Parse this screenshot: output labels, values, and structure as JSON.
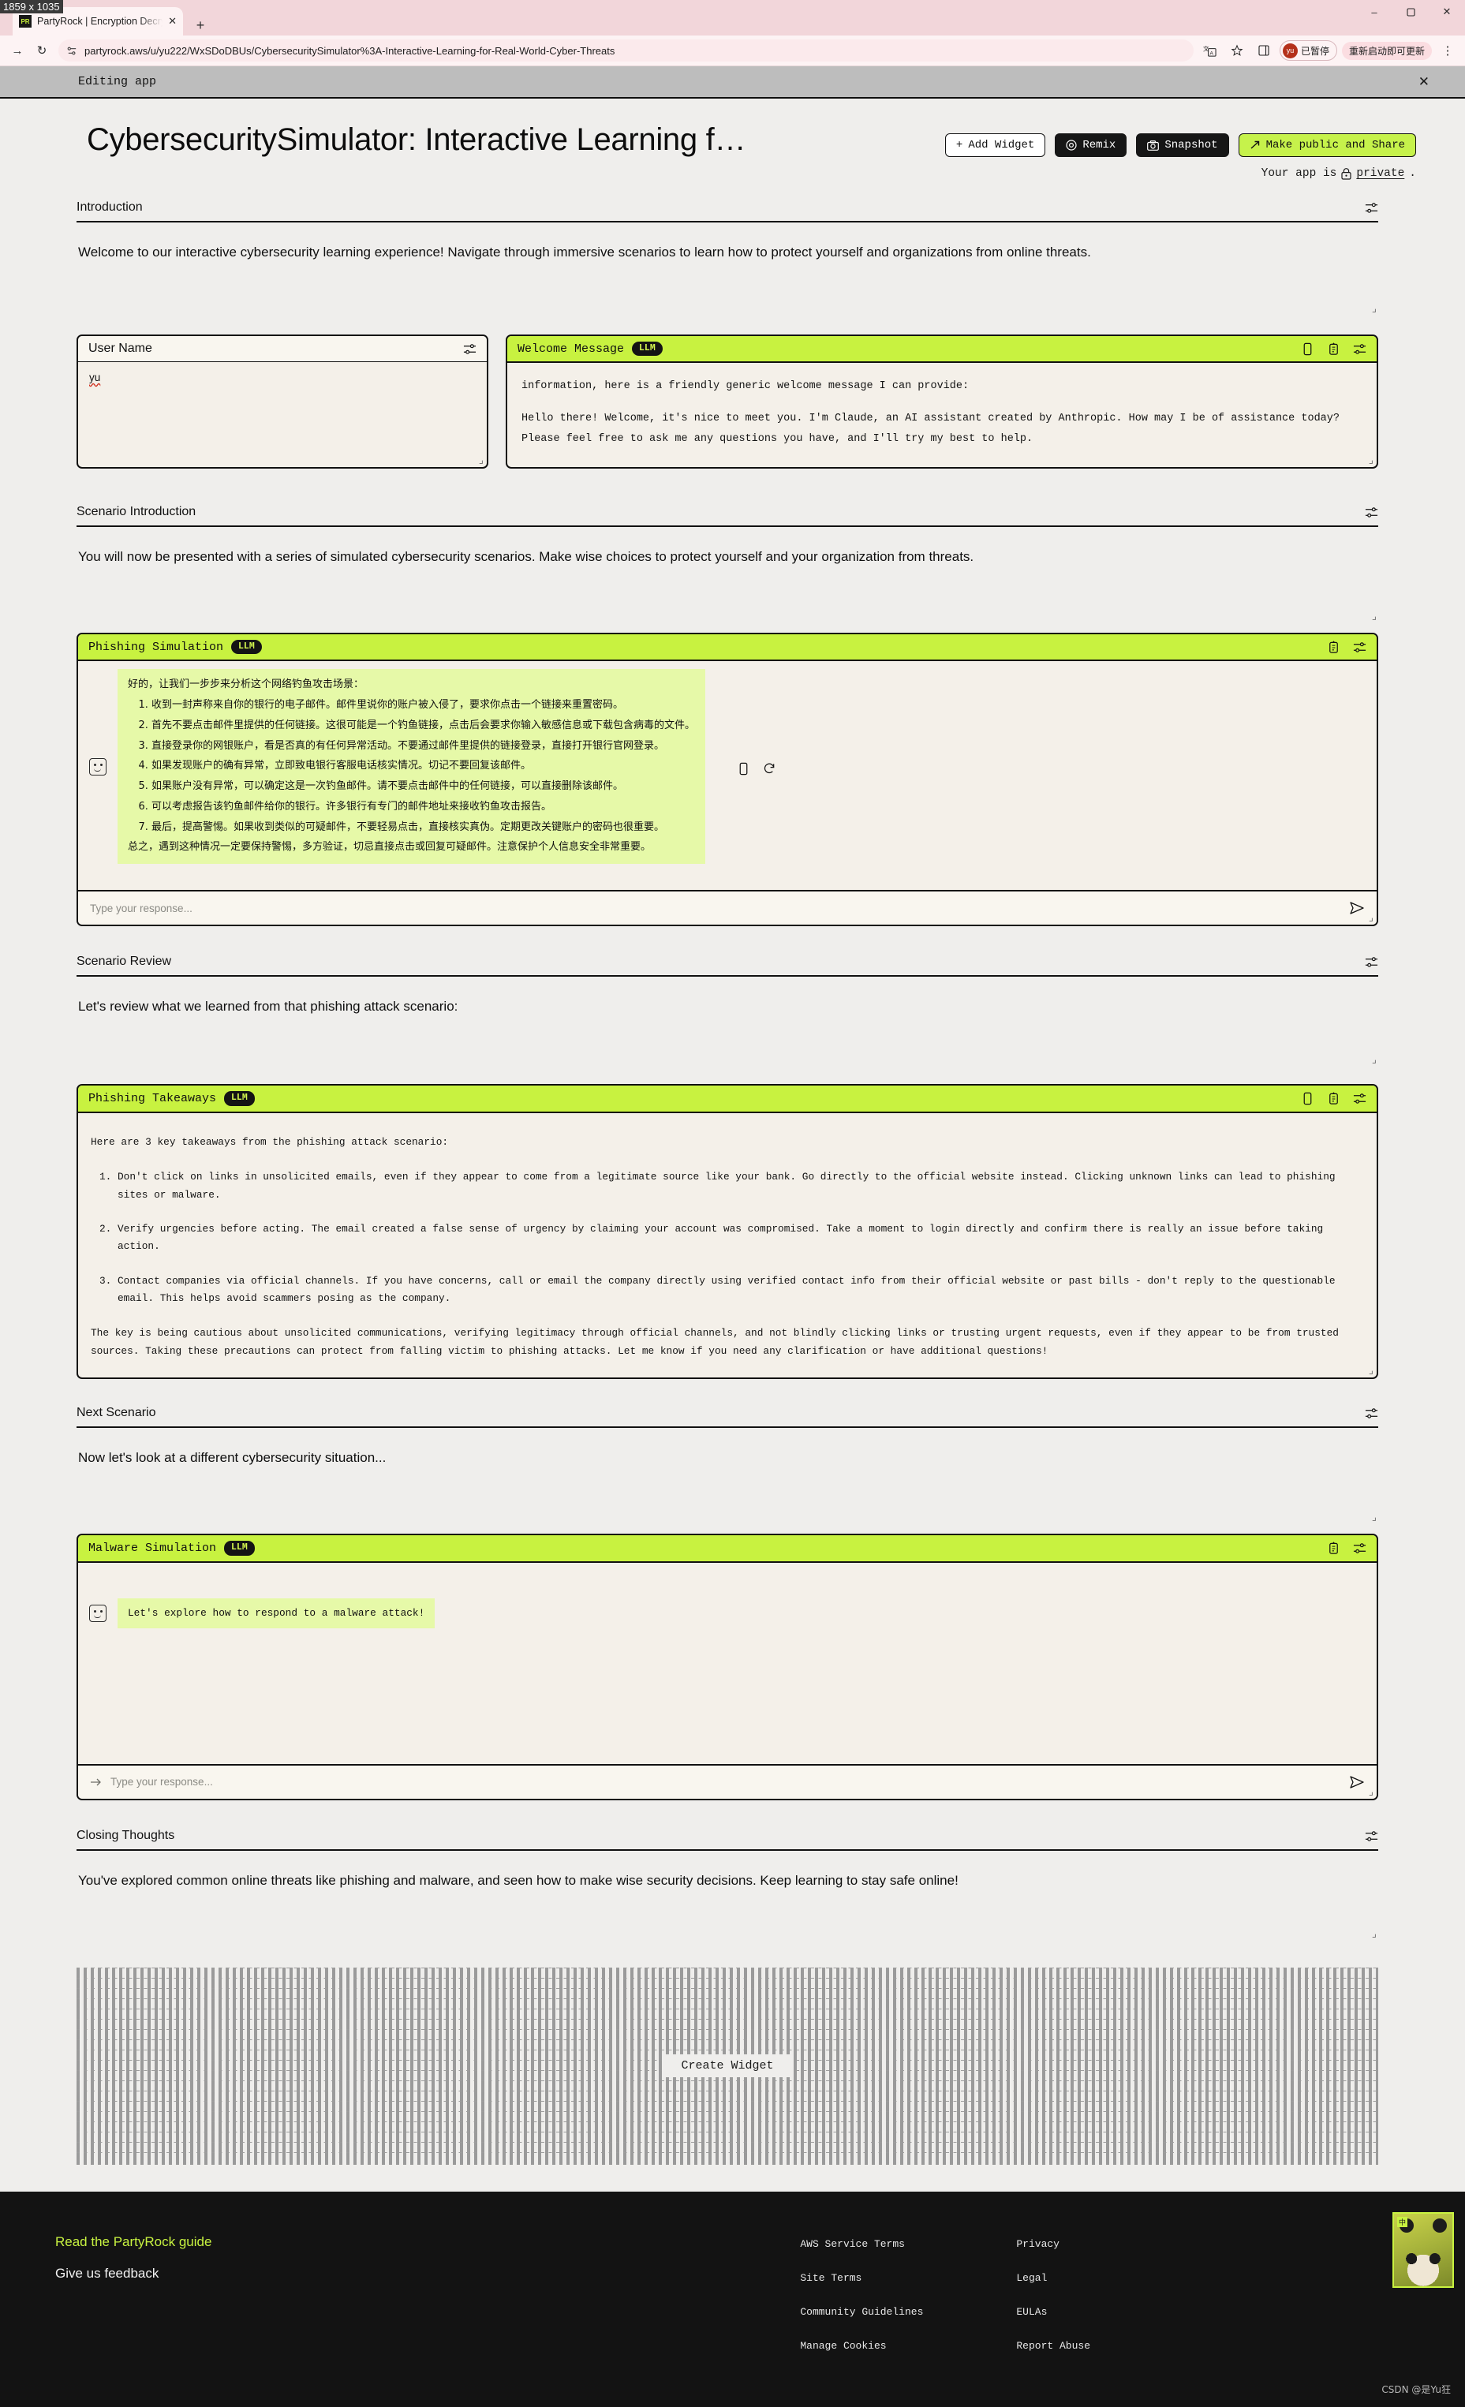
{
  "browser": {
    "size_badge": "1859 x 1035",
    "tab": {
      "favicon_text": "PR",
      "title": "PartyRock | Encryption Decry",
      "close_icon": "close-icon"
    },
    "new_tab_label": "+",
    "window_controls": {
      "minimize": "–",
      "maximize": "❐",
      "close": "✕"
    },
    "nav": {
      "forward": "→",
      "reload": "↻"
    },
    "url": "partyrock.aws/u/yu222/WxSDoDBUs/CybersecuritySimulator%3A-Interactive-Learning-for-Real-World-Cyber-Threats",
    "profile": {
      "avatar_initials": "yu",
      "status_text": "已暂停"
    },
    "update_pill": "重新启动即可更新"
  },
  "editing_bar": {
    "label": "Editing app",
    "close_icon": "✕"
  },
  "header": {
    "title": "CybersecuritySimulator: Interactive Learning f…",
    "buttons": [
      {
        "label": "Add Widget",
        "icon": "plus-icon",
        "style": "light"
      },
      {
        "label": "Remix",
        "icon": "remix-icon",
        "style": "dark"
      },
      {
        "label": "Snapshot",
        "icon": "camera-icon",
        "style": "dark"
      },
      {
        "label": "Make public and Share",
        "icon": "arrow-share-icon",
        "style": "accent"
      }
    ],
    "privacy_prefix": "Your app is",
    "privacy_value": "private",
    "privacy_suffix": "."
  },
  "sections": {
    "introduction": {
      "title": "Introduction",
      "body": "Welcome to our interactive cybersecurity learning experience! Navigate through immersive scenarios to learn how to protect yourself and organizations from online threats."
    },
    "scenario_introduction": {
      "title": "Scenario Introduction",
      "body": "You will now be presented with a series of simulated cybersecurity scenarios. Make wise choices to protect yourself and your organization from threats."
    },
    "scenario_review": {
      "title": "Scenario Review",
      "body": "Let's review what we learned from that phishing attack scenario:"
    },
    "next_scenario": {
      "title": "Next Scenario",
      "body": "Now let's look at a different cybersecurity situation..."
    },
    "closing_thoughts": {
      "title": "Closing Thoughts",
      "body": "You've explored common online threats like phishing and malware, and seen how to make wise security decisions. Keep learning to stay safe online!"
    }
  },
  "username_widget": {
    "title": "User Name",
    "value": "yu"
  },
  "welcome_widget": {
    "title": "Welcome Message",
    "badge": "LLM",
    "clipped_line": ", , , ",
    "line1": "information, here is a friendly generic welcome message I can provide:",
    "line2": "Hello there! Welcome, it's nice to meet you. I'm Claude, an AI assistant created by Anthropic. How may I be of assistance today? Please feel free to ask me any questions you have, and I'll try my best to help."
  },
  "phishing_sim": {
    "title": "Phishing Simulation",
    "badge": "LLM",
    "intro": "好的，让我们一步步来分析这个网络钓鱼攻击场景：",
    "steps": [
      "收到一封声称来自你的银行的电子邮件。邮件里说你的账户被入侵了，要求你点击一个链接来重置密码。",
      "首先不要点击邮件里提供的任何链接。这很可能是一个钓鱼链接，点击后会要求你输入敏感信息或下载包含病毒的文件。",
      "直接登录你的网银账户，看是否真的有任何异常活动。不要通过邮件里提供的链接登录，直接打开银行官网登录。",
      "如果发现账户的确有异常，立即致电银行客服电话核实情况。切记不要回复该邮件。",
      "如果账户没有异常，可以确定这是一次钓鱼邮件。请不要点击邮件中的任何链接，可以直接删除该邮件。",
      "可以考虑报告该钓鱼邮件给你的银行。许多银行有专门的邮件地址来接收钓鱼攻击报告。",
      "最后，提高警惕。如果收到类似的可疑邮件，不要轻易点击，直接核实真伪。定期更改关键账户的密码也很重要。"
    ],
    "outro": "总之，遇到这种情况一定要保持警惕，多方验证，切忌直接点击或回复可疑邮件。注意保护个人信息安全非常重要。",
    "input_placeholder": "Type your response..."
  },
  "phishing_takeaways": {
    "title": "Phishing Takeaways",
    "badge": "LLM",
    "intro": "Here are 3 key takeaways from the phishing attack scenario:",
    "items": [
      "Don't click on links in unsolicited emails, even if they appear to come from a legitimate source like your bank. Go directly to the official website instead. Clicking unknown links can lead to phishing sites or malware.",
      "Verify urgencies before acting. The email created a false sense of urgency by claiming your account was compromised. Take a moment to login directly and confirm there is really an issue before taking action.",
      "Contact companies via official channels. If you have concerns, call or email the company directly using verified contact info from their official website or past bills - don't reply to the questionable email. This helps avoid scammers posing as the company."
    ],
    "outro": "The key is being cautious about unsolicited communications, verifying legitimacy through official channels, and not blindly clicking links or trusting urgent requests, even if they appear to be from trusted sources. Taking these precautions can protect from falling victim to phishing attacks. Let me know if you need any clarification or have additional questions!"
  },
  "malware_sim": {
    "title": "Malware Simulation",
    "badge": "LLM",
    "message": "Let's explore how to respond to a malware attack!",
    "input_placeholder": "Type your response..."
  },
  "create_widget": {
    "label": "Create Widget"
  },
  "footer": {
    "guide": "Read the PartyRock guide",
    "feedback": "Give us feedback",
    "col1": [
      "AWS Service Terms",
      "Site Terms",
      "Community Guidelines",
      "Manage Cookies"
    ],
    "col2": [
      "Privacy",
      "Legal",
      "EULAs",
      "Report Abuse"
    ],
    "watermark": "CSDN @是Yu狂",
    "watermark_badge": "中"
  },
  "colors": {
    "accent": "#c8f240",
    "page_bg": "#efeeec",
    "card_bg": "#f4f0e9",
    "bubble": "#e6f9a8",
    "footer_bg": "#131313"
  }
}
